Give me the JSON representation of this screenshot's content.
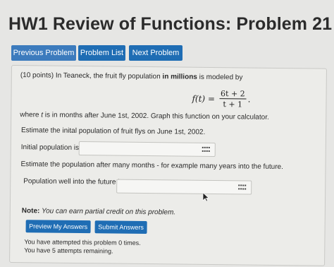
{
  "header": {
    "title": "HW1 Review of Functions: Problem 21"
  },
  "nav": {
    "previous_label": "Previous Problem",
    "list_label": "Problem List",
    "next_label": "Next Problem"
  },
  "problem": {
    "intro_prefix": "(10 points) In Teaneck, the fruit fly population ",
    "intro_bold": "in millions",
    "intro_suffix": " is modeled by",
    "formula_lhs": "f(t) =",
    "formula_numerator": "6t + 2",
    "formula_denominator": "t + 1",
    "formula_end": ".",
    "where_prefix": "where ",
    "where_var": "t",
    "where_suffix": " is in months after June 1st, 2002. Graph this function on your calculator.",
    "q1_text": "Estimate the inital population of fruit flys on June 1st, 2002.",
    "q1_label": "Initial population is",
    "q1_value": "",
    "q2_text": "Estimate the population after many months - for example many years into the future.",
    "q2_label": "Population well into the future is",
    "q2_value": ""
  },
  "footer": {
    "note_label": "Note:",
    "note_text": " You can earn partial credit on this problem.",
    "preview_label": "Preview My Answers",
    "submit_label": "Submit Answers",
    "attempted_text": "You have attempted this problem 0 times.",
    "remaining_text": "You have 5 attempts remaining."
  },
  "colors": {
    "button": "#1f6db4",
    "background": "#e6e6e4"
  },
  "icons": {
    "input_helper": "keyboard-grid-icon",
    "pointer": "mouse-cursor-icon"
  }
}
